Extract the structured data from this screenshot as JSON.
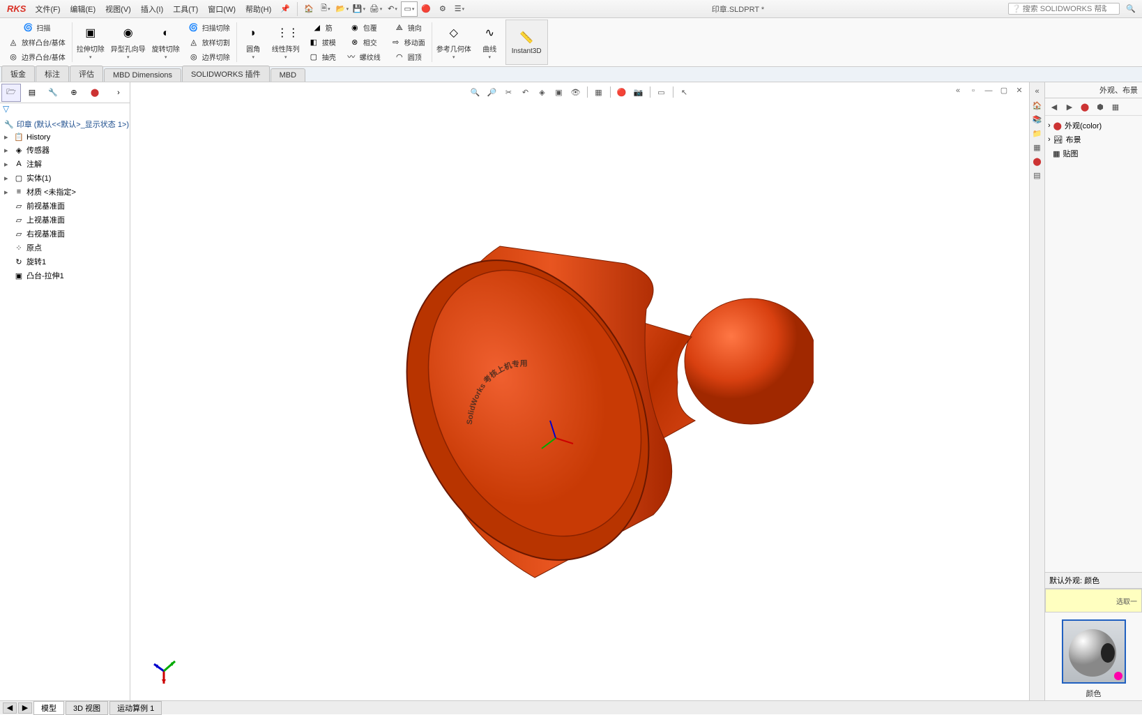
{
  "app": {
    "logo": "RKS"
  },
  "menubar": {
    "items": [
      {
        "label": "文件(F)"
      },
      {
        "label": "编辑(E)"
      },
      {
        "label": "视图(V)"
      },
      {
        "label": "插入(I)"
      },
      {
        "label": "工具(T)"
      },
      {
        "label": "窗口(W)"
      },
      {
        "label": "帮助(H)"
      }
    ],
    "title": "印章.SLDPRT *",
    "search_placeholder": "搜索 SOLIDWORKS 帮助"
  },
  "ribbon": {
    "scan": "扫描",
    "loft": "放样凸台/基体",
    "boundary": "边界凸台/基体",
    "extrude_cut": "拉伸切除",
    "hole_wizard": "异型孔向导",
    "revolve_cut": "旋转切除",
    "sweep_cut": "扫描切除",
    "loft_cut": "放样切割",
    "boundary_cut": "边界切除",
    "fillet": "圆角",
    "pattern": "线性阵列",
    "rib": "筋",
    "draft": "拔模",
    "shell": "抽壳",
    "wrap": "包覆",
    "intersect": "相交",
    "thread": "螺纹线",
    "mirror": "镜向",
    "move_face": "移动面",
    "dome": "圆顶",
    "ref_geom": "参考几何体",
    "curves": "曲线",
    "instant3d": "Instant3D"
  },
  "tabs": {
    "items": [
      {
        "label": "钣金"
      },
      {
        "label": "标注"
      },
      {
        "label": "评估"
      },
      {
        "label": "MBD Dimensions"
      },
      {
        "label": "SOLIDWORKS 插件"
      },
      {
        "label": "MBD"
      }
    ]
  },
  "feature_tree": {
    "root": "印章  (默认<<默认>_显示状态 1>)",
    "nodes": [
      {
        "icon": "📋",
        "label": "History"
      },
      {
        "icon": "◈",
        "label": "传感器"
      },
      {
        "icon": "A",
        "label": "注解"
      },
      {
        "icon": "▢",
        "label": "实体(1)"
      },
      {
        "icon": "≡",
        "label": "材质 <未指定>"
      },
      {
        "icon": "▱",
        "label": "前视基准面"
      },
      {
        "icon": "▱",
        "label": "上视基准面"
      },
      {
        "icon": "▱",
        "label": "右视基准面"
      },
      {
        "icon": "⁘",
        "label": "原点"
      },
      {
        "icon": "↻",
        "label": "旋转1"
      },
      {
        "icon": "▣",
        "label": "凸台-拉伸1"
      }
    ]
  },
  "rightpanel": {
    "header": "外观、布景",
    "nodes": [
      {
        "icon": "🔴",
        "label": "外观(color)"
      },
      {
        "icon": "🏞",
        "label": "布景"
      },
      {
        "icon": "▦",
        "label": "贴图"
      }
    ],
    "section_title": "默认外观: 颜色",
    "yellow_text": "选取一",
    "thumb_label": "颜色"
  },
  "bottom": {
    "tabs": [
      {
        "label": "模型"
      },
      {
        "label": "3D 视图"
      },
      {
        "label": "运动算例 1"
      }
    ]
  },
  "model_text": "SolidWorks 考核上机专用"
}
